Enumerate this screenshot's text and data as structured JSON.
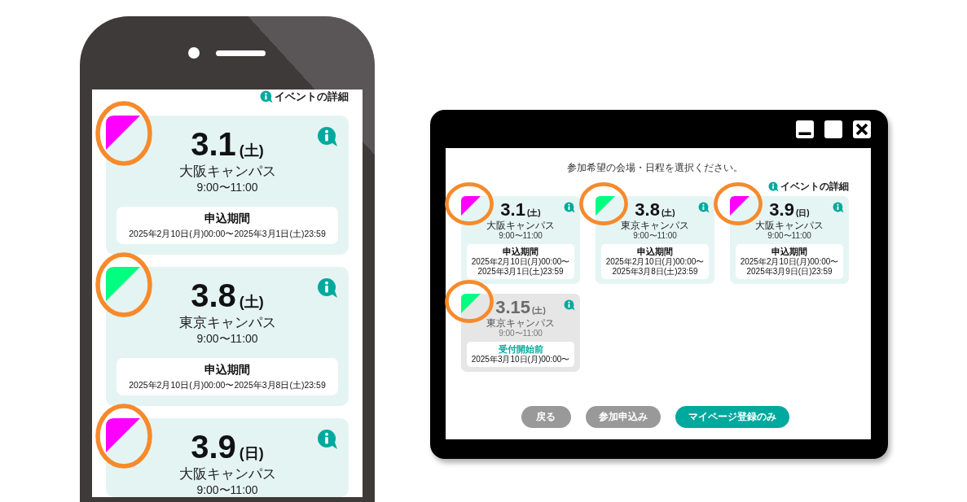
{
  "phone": {
    "details_link": "イベントの詳細",
    "cards": [
      {
        "date": "3.1",
        "weekday": "(土)",
        "venue": "大阪キャンパス",
        "time": "9:00〜11:00",
        "period_label": "申込期間",
        "period": "2025年2月10日(月)00:00〜2025年3月1日(土)23:59",
        "color": "#ff00ff",
        "highlighted": true
      },
      {
        "date": "3.8",
        "weekday": "(土)",
        "venue": "東京キャンパス",
        "time": "9:00〜11:00",
        "period_label": "申込期間",
        "period": "2025年2月10日(月)00:00〜2025年3月8日(土)23:59",
        "color": "#00ff80",
        "highlighted": true
      },
      {
        "date": "3.9",
        "weekday": "(日)",
        "venue": "大阪キャンパス",
        "time": "9:00〜11:00",
        "color": "#ff00ff",
        "highlighted": true
      }
    ]
  },
  "desktop_window": {
    "instruction": "参加希望の会場・日程を選択ください。",
    "details_link": "イベントの詳細",
    "cards": [
      {
        "date": "3.1",
        "weekday": "(土)",
        "venue": "大阪キャンパス",
        "time": "9:00〜11:00",
        "period_label": "申込期間",
        "period": "2025年2月10日(月)00:00〜2025年3月1日(土)23:59",
        "color": "#ff00ff",
        "highlighted": true,
        "disabled": false
      },
      {
        "date": "3.8",
        "weekday": "(土)",
        "venue": "東京キャンパス",
        "time": "9:00〜11:00",
        "period_label": "申込期間",
        "period": "2025年2月10日(月)00:00〜2025年3月8日(土)23:59",
        "color": "#00ff80",
        "highlighted": true,
        "disabled": false
      },
      {
        "date": "3.9",
        "weekday": "(日)",
        "venue": "大阪キャンパス",
        "time": "9:00〜11:00",
        "period_label": "申込期間",
        "period": "2025年2月10日(月)00:00〜2025年3月9日(日)23:59",
        "color": "#ff00ff",
        "highlighted": true,
        "disabled": false
      },
      {
        "date": "3.15",
        "weekday": "(土)",
        "venue": "東京キャンパス",
        "time": "9:00〜11:00",
        "period_label": "受付開始前",
        "period": "2025年3月10日(月)00:00〜",
        "color": "#00ff80",
        "highlighted": true,
        "disabled": true
      }
    ],
    "buttons": [
      {
        "label": "戻る",
        "kind": "secondary"
      },
      {
        "label": "参加申込み",
        "kind": "secondary"
      },
      {
        "label": "マイページ登録のみ",
        "kind": "primary"
      }
    ]
  }
}
